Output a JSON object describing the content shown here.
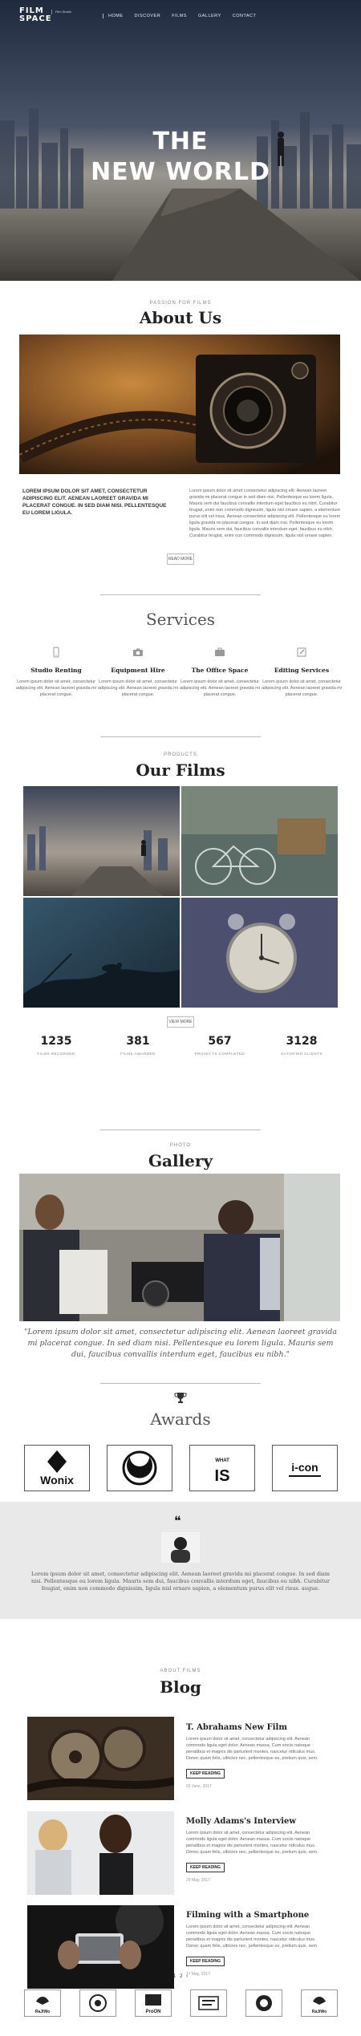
{
  "header": {
    "logo": "FILM\nSPACE",
    "logo_sub": "Film Studio",
    "nav": [
      "HOME",
      "DISCOVER",
      "FILMS",
      "GALLERY",
      "CONTACT"
    ]
  },
  "hero": {
    "title": "THE\nNEW WORLD"
  },
  "about": {
    "eyebrow": "PASSION FOR FILMS",
    "title": "About Us",
    "lead": "LOREM IPSUM DOLOR SIT AMET, CONSECTETUR ADIPISCING ELIT. AENEAN LAOREET GRAVIDA MI PLACERAT CONGUE. IN SED DIAM NISI. PELLENTESQUE EU LOREM LIGULA.",
    "body": "Lorem ipsum dolor sit amet consectetur adipiscing elit. Aenean laoreet gravida mi placerat congue in sed diam nisi. Pellentesque eu lorem ligula. Mauris sem dui faucibus convallis interdum eget faucibus eu nibh. Curabitur feugiat, enim non commodo dignissim, ligula nisl ornare sapien, a elementum purus elit vel risus. Aenean consectetur adipiscing elit. Pellentesque eu lorem ligula gravida mi placerat congue. In sed diam nisi. Pellentesque eu lorem ligula. Mauris sem dui, faucibus convallis interdum eget, faucibus eu nibh. Curabitur feugiat, enim non commodo dignissim, ligula nisl ornare sapien.",
    "button": "READ MORE"
  },
  "services": {
    "title": "Services",
    "items": [
      {
        "icon": "phone-icon",
        "title": "Studio Renting",
        "text": "Lorem ipsum dolor sit amet, consectetur adipiscing elit. Aenean laoreet gravida mi placerat congue."
      },
      {
        "icon": "camera-icon",
        "title": "Equipment Hire",
        "text": "Lorem ipsum dolor sit amet, consectetur adipiscing elit. Aenean laoreet gravida mi placerat congue."
      },
      {
        "icon": "briefcase-icon",
        "title": "The Office Space",
        "text": "Lorem ipsum dolor sit amet, consectetur adipiscing elit. Aenean laoreet gravida mi placerat congue."
      },
      {
        "icon": "pencil-icon",
        "title": "Editing Services",
        "text": "Lorem ipsum dolor sit amet, consectetur adipiscing elit. Aenean laoreet gravida mi placerat congue."
      }
    ]
  },
  "films": {
    "eyebrow": "PRODUCTS",
    "title": "Our Films",
    "button": "VIEW MORE"
  },
  "stats": [
    {
      "value": "1235",
      "label": "FILMS RECORDED"
    },
    {
      "value": "381",
      "label": "FILMS AWARDED"
    },
    {
      "value": "567",
      "label": "PROJECTS COMPLETED"
    },
    {
      "value": "3128",
      "label": "SATISFIED CLIENTS"
    }
  ],
  "gallery": {
    "eyebrow": "PHOTO",
    "title": "Gallery",
    "quote": "\"Lorem ipsum dolor sit amet, consectetur adipiscing elit. Aenean laoreet gravida mi placerat congue. In sed diam nisi. Pellentesque eu lorem ligula. Mauris sem dui, faucibus convallis interdum eget, faucibus eu nibh.\""
  },
  "awards": {
    "title": "Awards",
    "logos": [
      "Wonix",
      "",
      "WHAT IS",
      "i-con"
    ]
  },
  "testimonial": {
    "quote_mark": "❝",
    "text": "Lorem ipsum dolor sit amet, consectetur adipiscing elit. Aenean laoreet gravida mi placerat congue. In sed diam nisi. Pellentesque eu lorem ligula. Mauris sem dui, faucibus convallis interdum eget, faucibus eu nibh. Curabitur feugiat, enim non commodo dignissim, ligula nisl ornare sapien, a elementum purus elit vel risus. augue."
  },
  "blog": {
    "eyebrow": "ABOUT FILMS",
    "title": "Blog",
    "posts": [
      {
        "title": "T. Abrahams New Film",
        "text": "Lorem ipsum dolor sit amet, consectetur adipiscing elit. Aenean commodo ligula eget dolor. Aenean massa. Cum sociis natoque penatibus et magnis dis parturient montes, nascetur ridiculus mus. Donec quam felis, ultricies nec, pellentesque eu, pretium quis, sem.",
        "button": "KEEP READING",
        "date": "03 June, 2017"
      },
      {
        "title": "Molly Adams's Interview",
        "text": "Lorem ipsum dolor sit amet, consectetur adipiscing elit. Aenean commodo ligula eget dolor. Aenean massa. Cum sociis natoque penatibus et magnis dis parturient montes, nascetur ridiculus mus. Donec quam felis, ultricies nec, pellentesque eu, pretium quis, sem.",
        "button": "KEEP READING",
        "date": "29 May, 2017"
      },
      {
        "title": "Filming with a Smartphone",
        "text": "Lorem ipsum dolor sit amet, consectetur adipiscing elit. Aenean commodo ligula eget dolor. Aenean massa. Cum sociis natoque penatibus et magnis dis parturient montes, nascetur ridiculus mus. Donec quam felis, ultricies nec, pellentesque eu, pretium quis, sem.",
        "button": "KEEP READING",
        "date": "17 May, 2017"
      }
    ],
    "pagination": [
      "1",
      "2",
      "›"
    ]
  },
  "footer_logos": [
    "RaJiWo",
    "",
    "ProON",
    "",
    "",
    "RaJiWo"
  ],
  "colors": {
    "hero_dark": "#1d2536",
    "testimonial_bg": "#e9e9ea",
    "text": "#333333"
  }
}
